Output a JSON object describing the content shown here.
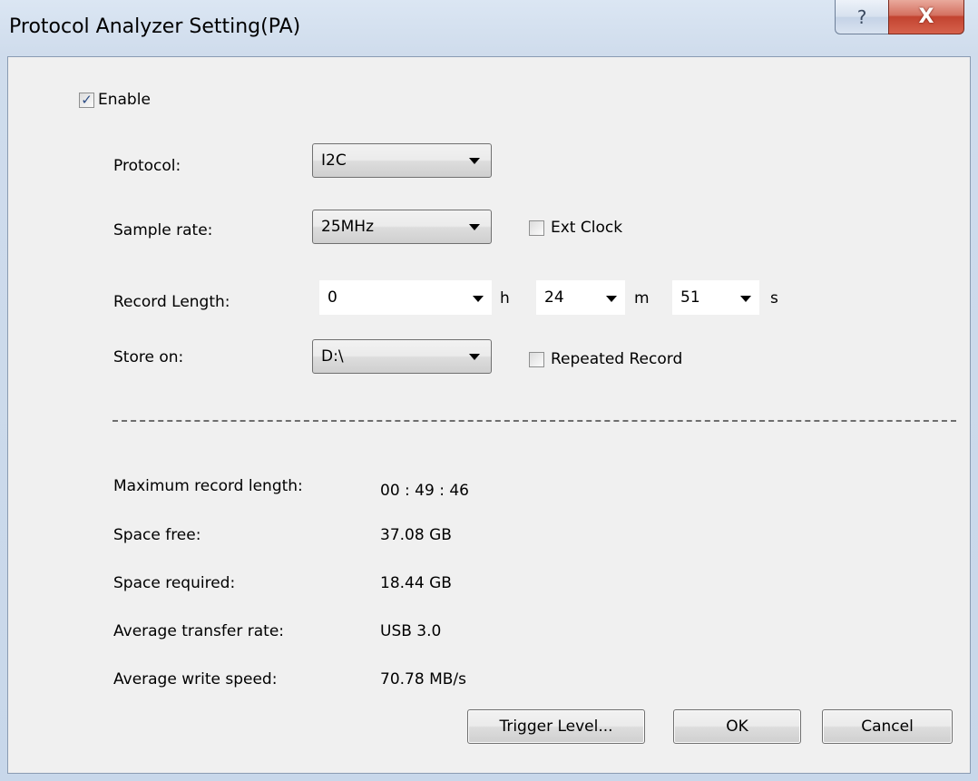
{
  "window": {
    "title": "Protocol Analyzer Setting(PA)",
    "help_glyph": "?",
    "close_glyph": "X"
  },
  "enable": {
    "label": "Enable",
    "checked": true
  },
  "protocol": {
    "label": "Protocol:",
    "value": "I2C"
  },
  "sample_rate": {
    "label": "Sample rate:",
    "value": "25MHz",
    "ext_clock": {
      "label": "Ext Clock",
      "checked": false
    }
  },
  "record_length": {
    "label": "Record Length:",
    "hours": "0",
    "hours_unit": "h",
    "minutes": "24",
    "minutes_unit": "m",
    "seconds": "51",
    "seconds_unit": "s"
  },
  "store_on": {
    "label": "Store on:",
    "value": "D:\\",
    "repeated_record": {
      "label": "Repeated Record",
      "checked": false
    }
  },
  "info": [
    {
      "label": "Maximum record length:",
      "value": "00 : 49 : 46"
    },
    {
      "label": "Space free:",
      "value": "37.08 GB"
    },
    {
      "label": "Space required:",
      "value": "18.44 GB"
    },
    {
      "label": "Average transfer rate:",
      "value": "USB 3.0"
    },
    {
      "label": "Average write speed:",
      "value": "70.78 MB/s"
    }
  ],
  "buttons": {
    "trigger_level": "Trigger Level...",
    "ok": "OK",
    "cancel": "Cancel"
  },
  "colors": {
    "client_bg": "#f0f0f0",
    "close_button": "#c24330",
    "checkmark": "#2d4d85"
  }
}
